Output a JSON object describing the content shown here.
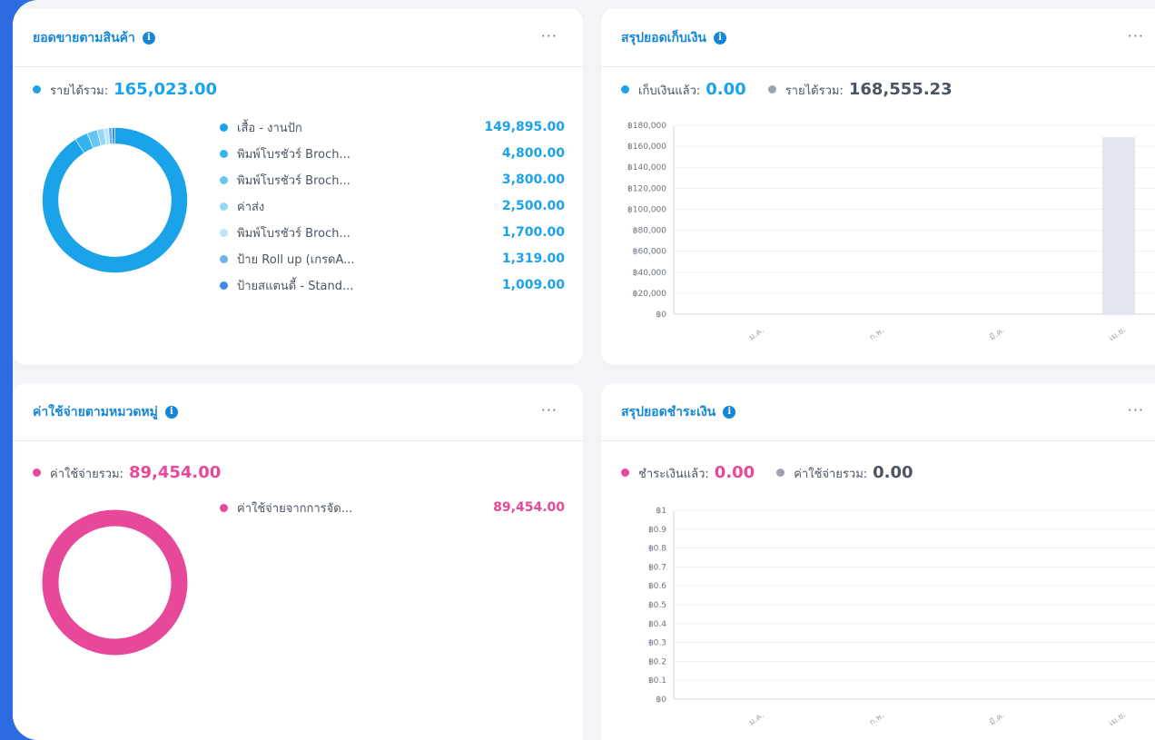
{
  "colors": {
    "blue": "#1AA3E8",
    "pink": "#E8489A",
    "grey": "#9CA3AF",
    "accent": "#1687D6"
  },
  "sales_by_product": {
    "title": "ยอดขายตามสินค้า",
    "more": "···",
    "total_label": "รายได้รวม:",
    "total_value": "165,023.00",
    "items": [
      {
        "name": "เสื้อ - งานปัก",
        "value": "149,895.00",
        "color": "#1AA3E8"
      },
      {
        "name": "พิมพ์โบรชัวร์ Broch...",
        "value": "4,800.00",
        "color": "#35B3EC"
      },
      {
        "name": "พิมพ์โบรชัวร์ Broch...",
        "value": "3,800.00",
        "color": "#66C8F0"
      },
      {
        "name": "ค่าส่ง",
        "value": "2,500.00",
        "color": "#94D8F4"
      },
      {
        "name": "พิมพ์โบรชัวร์ Broch...",
        "value": "1,700.00",
        "color": "#BDE7F8"
      },
      {
        "name": "ป้าย Roll up (เกรดA...",
        "value": "1,319.00",
        "color": "#6FB3EE"
      },
      {
        "name": "ป้ายสแตนดี้ - Stand...",
        "value": "1,009.00",
        "color": "#3D8BE8"
      }
    ]
  },
  "collection_summary": {
    "title": "สรุปยอดเก็บเงิน",
    "more": "···",
    "collected_label": "เก็บเงินแล้ว:",
    "collected_value": "0.00",
    "revenue_label": "รายได้รวม:",
    "revenue_value": "168,555.23"
  },
  "expense_by_category": {
    "title": "ค่าใช้จ่ายตามหมวดหมู่",
    "more": "···",
    "total_label": "ค่าใช้จ่ายรวม:",
    "total_value": "89,454.00",
    "items": [
      {
        "name": "ค่าใช้จ่ายจากการจัด...",
        "value": "89,454.00",
        "color": "#E8489A"
      }
    ]
  },
  "payment_summary": {
    "title": "สรุปยอดชำระเงิน",
    "more": "···",
    "paid_label": "ชำระเงินแล้ว:",
    "paid_value": "0.00",
    "expense_label": "ค่าใช้จ่ายรวม:",
    "expense_value": "0.00"
  },
  "chart_data": [
    {
      "type": "pie",
      "categories": [
        "เสื้อ - งานปัก",
        "พิมพ์โบรชัวร์ Broch...",
        "พิมพ์โบรชัวร์ Broch...",
        "ค่าส่ง",
        "พิมพ์โบรชัวร์ Broch...",
        "ป้าย Roll up (เกรดA...",
        "ป้ายสแตนดี้ - Stand..."
      ],
      "values": [
        149895,
        4800,
        3800,
        2500,
        1700,
        1319,
        1009
      ]
    },
    {
      "type": "bar",
      "categories": [
        "ม.ค.",
        "ก.พ.",
        "มี.ค.",
        "เม.ย."
      ],
      "values": [
        0,
        0,
        0,
        168555.23
      ],
      "yticks": [
        "฿0",
        "฿20,000",
        "฿40,000",
        "฿60,000",
        "฿80,000",
        "฿100,000",
        "฿120,000",
        "฿140,000",
        "฿160,000",
        "฿180,000"
      ],
      "ylim": [
        0,
        180000
      ]
    },
    {
      "type": "pie",
      "categories": [
        "ค่าใช้จ่ายจากการจัด..."
      ],
      "values": [
        89454
      ]
    },
    {
      "type": "bar",
      "categories": [
        "ม.ค.",
        "ก.พ.",
        "มี.ค.",
        "เม.ย."
      ],
      "values": [
        0,
        0,
        0,
        0
      ],
      "yticks": [
        "฿0",
        "฿0.1",
        "฿0.2",
        "฿0.3",
        "฿0.4",
        "฿0.5",
        "฿0.6",
        "฿0.7",
        "฿0.8",
        "฿0.9",
        "฿1"
      ],
      "ylim": [
        0,
        1
      ]
    }
  ]
}
